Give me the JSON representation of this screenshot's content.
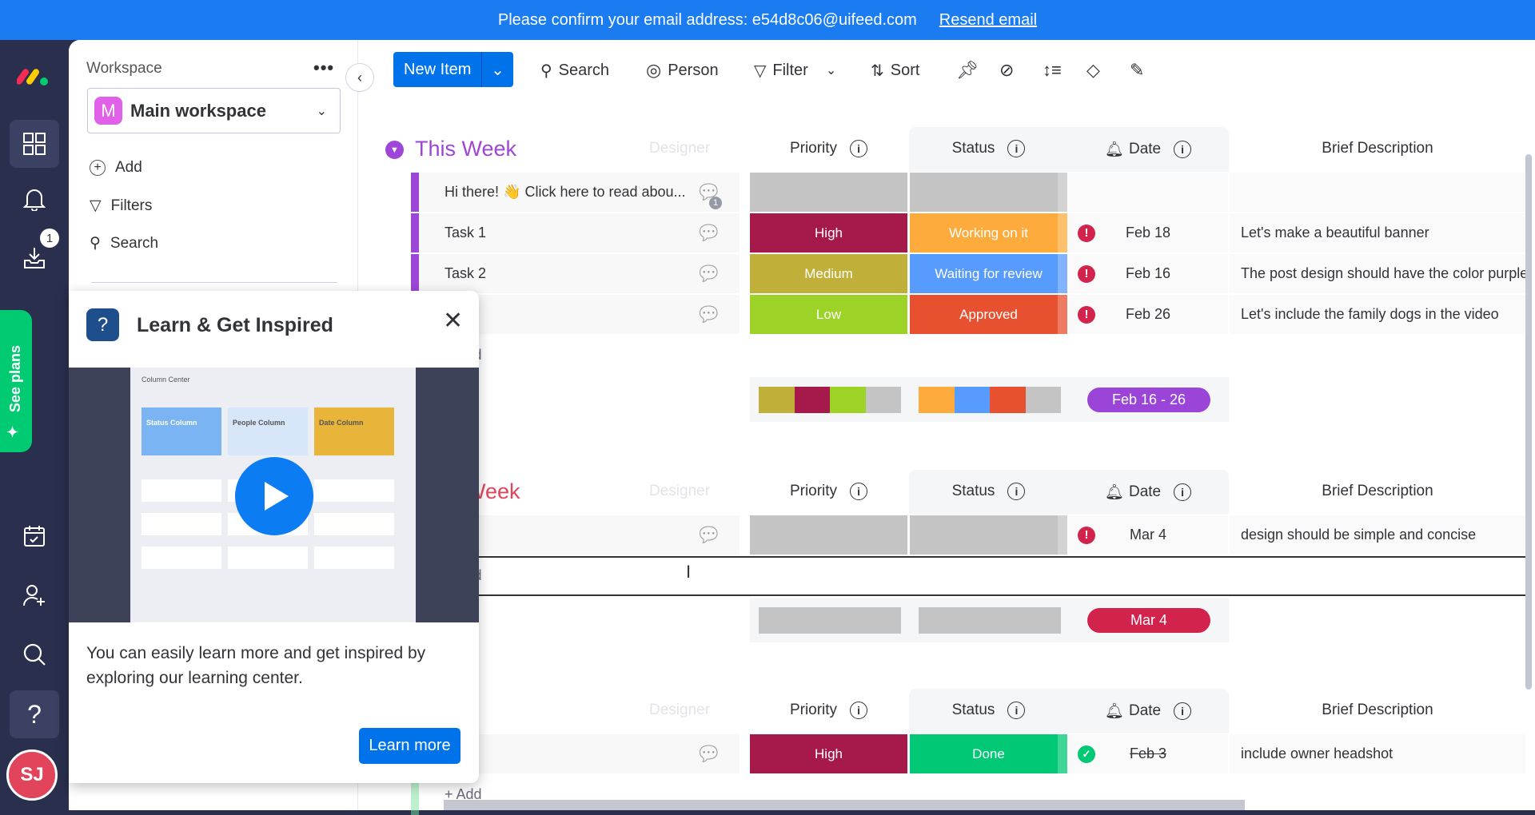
{
  "banner": {
    "text": "Please confirm your email address: e54d8c06@uifeed.com",
    "link": "Resend email",
    "color": "#1a7cf0"
  },
  "leftbar": {
    "notification_badge": "1",
    "see_plans": "See plans",
    "avatar_initials": "SJ",
    "avatar_color": "#e2445c",
    "icons": [
      "monday-logo-icon",
      "workspace-grid-icon",
      "bell-icon",
      "inbox-download-icon",
      "calendar-icon",
      "invite-person-icon",
      "search-icon",
      "help-icon"
    ]
  },
  "workspace": {
    "label": "Workspace",
    "selected": "Main workspace",
    "avatar_letter": "M",
    "menu": [
      "Add",
      "Filters",
      "Search"
    ]
  },
  "toolbar": {
    "new_item": "New Item",
    "search": "Search",
    "person": "Person",
    "filter": "Filter",
    "sort": "Sort",
    "icons": [
      "pin-icon",
      "hide-icon",
      "row-height-icon",
      "color-fill-icon",
      "edit-icon"
    ]
  },
  "columns": {
    "designer": "Designer",
    "priority": "Priority",
    "status": "Status",
    "date": "Date",
    "brief": "Brief Description"
  },
  "colors": {
    "High": "#a5194b",
    "Medium": "#c0b03a",
    "Low": "#9cd326",
    "Working on it": "#fdab3d",
    "Waiting for review": "#579bfc",
    "Approved": "#e8512f",
    "Done": "#00c875",
    "empty": "#c4c4c4"
  },
  "groups": [
    {
      "title": "This Week",
      "color": "#9d46d8",
      "rows": [
        {
          "name": "Hi there! 👋 Click here to read abou...",
          "priority": "",
          "status": "",
          "date": "",
          "date_icon": "",
          "brief": "",
          "updates": "1"
        },
        {
          "name": "Task 1",
          "priority": "High",
          "status": "Working on it",
          "date": "Feb 18",
          "date_icon": "alert",
          "brief": "Let's make a beautiful banner"
        },
        {
          "name": "Task 2",
          "priority": "Medium",
          "status": "Waiting for review",
          "date": "Feb 16",
          "date_icon": "alert",
          "brief": "The post design should have the color purple"
        },
        {
          "name": "",
          "priority": "Low",
          "status": "Approved",
          "date": "Feb 26",
          "date_icon": "alert",
          "brief": "Let's include the family dogs in the video"
        }
      ],
      "add": "+ Add",
      "summary_date": "Feb 16 - 26",
      "summary_color": "#9b45d8",
      "priority_mix": [
        "Medium",
        "High",
        "Low",
        "empty"
      ],
      "status_mix": [
        "Working on it",
        "Waiting for review",
        "Approved",
        "empty"
      ]
    },
    {
      "title": "Next Week",
      "color": "#e2445c",
      "rows": [
        {
          "name": "",
          "priority": "",
          "status": "",
          "date": "Mar 4",
          "date_icon": "alert",
          "brief": "design should be simple and concise"
        }
      ],
      "add": "+ Add",
      "summary_date": "Mar 4",
      "summary_color": "#d2234d",
      "priority_mix": [
        "empty"
      ],
      "status_mix": [
        "empty"
      ]
    },
    {
      "title": "",
      "color": "#7be2a0",
      "rows": [
        {
          "name": "",
          "priority": "High",
          "status": "Done",
          "date": "Feb 3",
          "date_icon": "check",
          "date_struck": true,
          "brief": "include owner headshot"
        }
      ],
      "add": "+ Add"
    }
  ],
  "popup": {
    "title": "Learn & Get Inspired",
    "body": "You can easily learn more and get inspired by exploring our learning center.",
    "button": "Learn more",
    "preview": {
      "title": "Column Center",
      "cards": [
        "Status Column",
        "People Column",
        "Date Column"
      ]
    }
  }
}
